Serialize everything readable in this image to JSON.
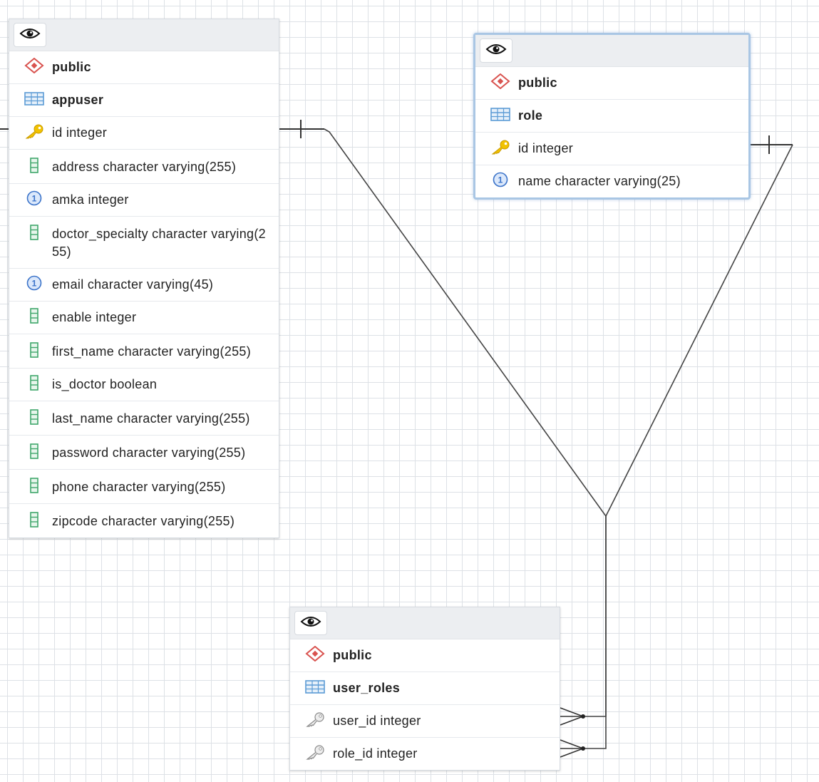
{
  "entities": {
    "appuser": {
      "schema": "public",
      "table": "appuser",
      "columns": [
        {
          "label": "id integer",
          "icon": "primary-key-icon"
        },
        {
          "label": "address character varying(255)",
          "icon": "column-icon"
        },
        {
          "label": "amka integer",
          "icon": "unique-column-icon"
        },
        {
          "label": "doctor_specialty character varying(255)",
          "icon": "column-icon"
        },
        {
          "label": "email character varying(45)",
          "icon": "unique-column-icon"
        },
        {
          "label": "enable integer",
          "icon": "column-icon"
        },
        {
          "label": "first_name character varying(255)",
          "icon": "column-icon"
        },
        {
          "label": "is_doctor boolean",
          "icon": "column-icon"
        },
        {
          "label": "last_name character varying(255)",
          "icon": "column-icon"
        },
        {
          "label": "password character varying(255)",
          "icon": "column-icon"
        },
        {
          "label": "phone character varying(255)",
          "icon": "column-icon"
        },
        {
          "label": "zipcode character varying(255)",
          "icon": "column-icon"
        }
      ]
    },
    "role": {
      "schema": "public",
      "table": "role",
      "columns": [
        {
          "label": "id integer",
          "icon": "primary-key-icon"
        },
        {
          "label": "name character varying(25)",
          "icon": "unique-column-icon"
        }
      ]
    },
    "user_roles": {
      "schema": "public",
      "table": "user_roles",
      "columns": [
        {
          "label": "user_id integer",
          "icon": "foreign-key-icon"
        },
        {
          "label": "role_id integer",
          "icon": "foreign-key-icon"
        }
      ]
    }
  },
  "relationships": [
    {
      "from": "appuser.id",
      "to": "user_roles.user_id",
      "from_cardinality": "one",
      "to_cardinality": "many"
    },
    {
      "from": "role.id",
      "to": "user_roles.role_id",
      "from_cardinality": "one",
      "to_cardinality": "many"
    }
  ],
  "colors": {
    "schema_icon": "#d9534f",
    "table_icon": "#5b9bd5",
    "primary_key_icon": "#e6b800",
    "column_icon": "#3fa66b",
    "unique_icon": "#3b73c9",
    "foreign_key_icon": "#9a9a9a",
    "selected_border": "#a9c6e4"
  }
}
